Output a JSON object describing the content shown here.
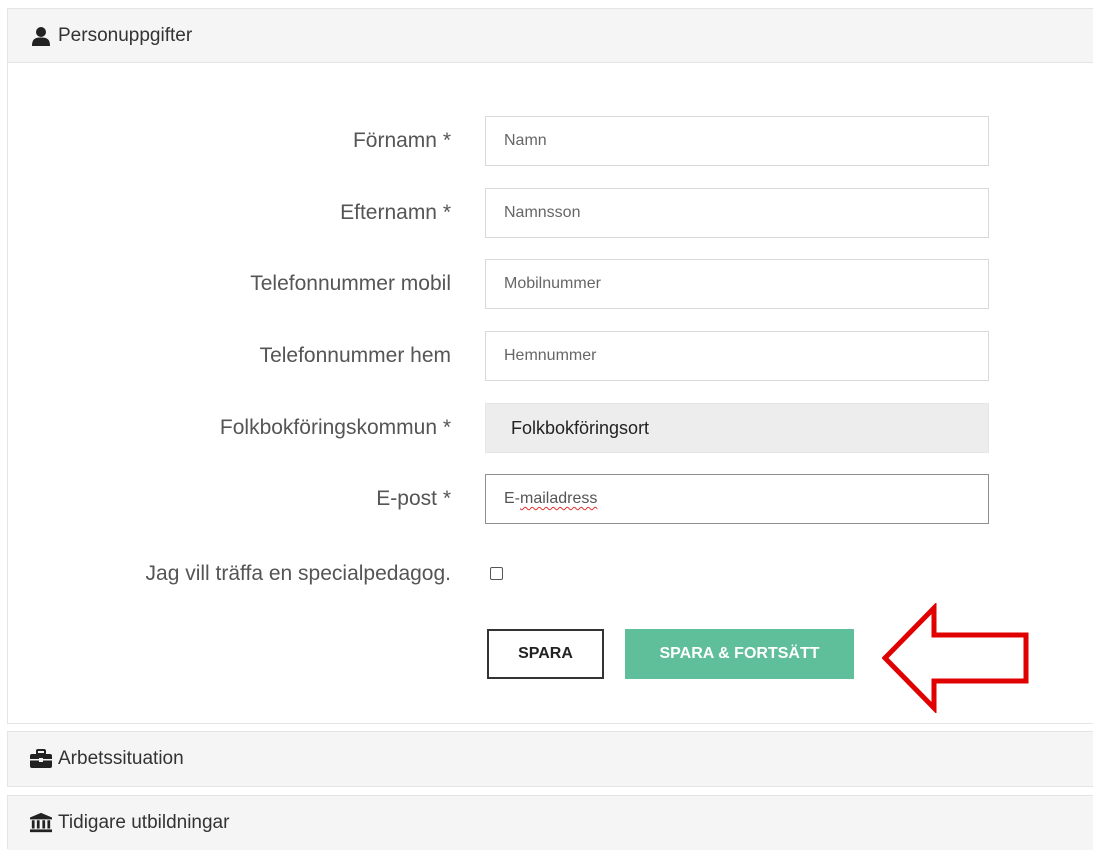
{
  "sections": {
    "personal": {
      "title": "Personuppgifter",
      "icon": "user-icon"
    },
    "work": {
      "title": "Arbetssituation",
      "icon": "briefcase-icon"
    },
    "education": {
      "title": "Tidigare utbildningar",
      "icon": "institution-icon"
    }
  },
  "form": {
    "fields": [
      {
        "label": "Förnamn *",
        "placeholder": "Namn"
      },
      {
        "label": "Efternamn *",
        "placeholder": "Namnsson"
      },
      {
        "label": "Telefonnummer mobil",
        "placeholder": "Mobilnummer"
      },
      {
        "label": "Telefonnummer hem",
        "placeholder": "Hemnummer"
      },
      {
        "label": "Folkbokföringskommun *",
        "value": "Folkbokföringsort"
      },
      {
        "label": "E-post *",
        "prefix": "E-",
        "spellword": "mailadress"
      }
    ],
    "checkbox": {
      "label": "Jag vill träffa en specialpedagog.",
      "checked": false
    },
    "buttons": {
      "save": "SPARA",
      "save_continue": "SPARA & FORTSÄTT"
    }
  },
  "colors": {
    "accent": "#5fbf9a",
    "arrow": "#e00000",
    "header_bg": "#f5f5f5"
  }
}
